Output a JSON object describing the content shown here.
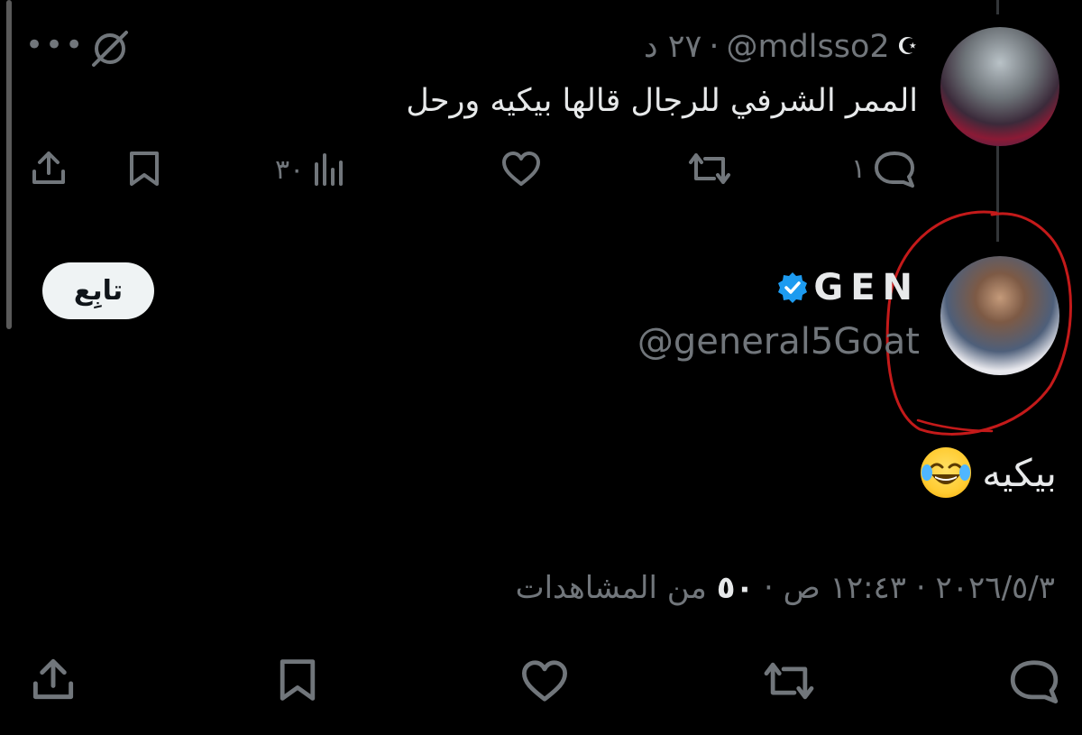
{
  "tweet1": {
    "handle": "@mdlsso2",
    "time": "٢٧ د",
    "separator": "·",
    "text": "الممر الشرفي للرجال قالها بيكيه ورحل",
    "replies": "١",
    "views": "٣٠",
    "icons": [
      "moon-icon",
      "more-icon",
      "grok-icon",
      "reply-icon",
      "retweet-icon",
      "like-icon",
      "views-icon",
      "bookmark-icon",
      "share-icon"
    ]
  },
  "tweet2": {
    "display_name": "GEN",
    "handle": "@general5Goat",
    "follow_label": "تابِع",
    "text": "بيكيه",
    "emoji": "face-with-tears-of-joy",
    "date": "٢٠٢٦/٥/٣",
    "time": "١٢:٤٣ ص",
    "views_count": "٥٠",
    "views_label": "من المشاهدات",
    "separator": "·",
    "icons": [
      "verified-icon",
      "reply-icon",
      "retweet-icon",
      "like-icon",
      "bookmark-icon",
      "share-icon"
    ]
  },
  "colors": {
    "background": "#000000",
    "text": "#e7e9ea",
    "muted": "#71767b",
    "verified": "#1d9bf0",
    "annotation": "#c41a1a",
    "follow_bg": "#eff3f4"
  }
}
